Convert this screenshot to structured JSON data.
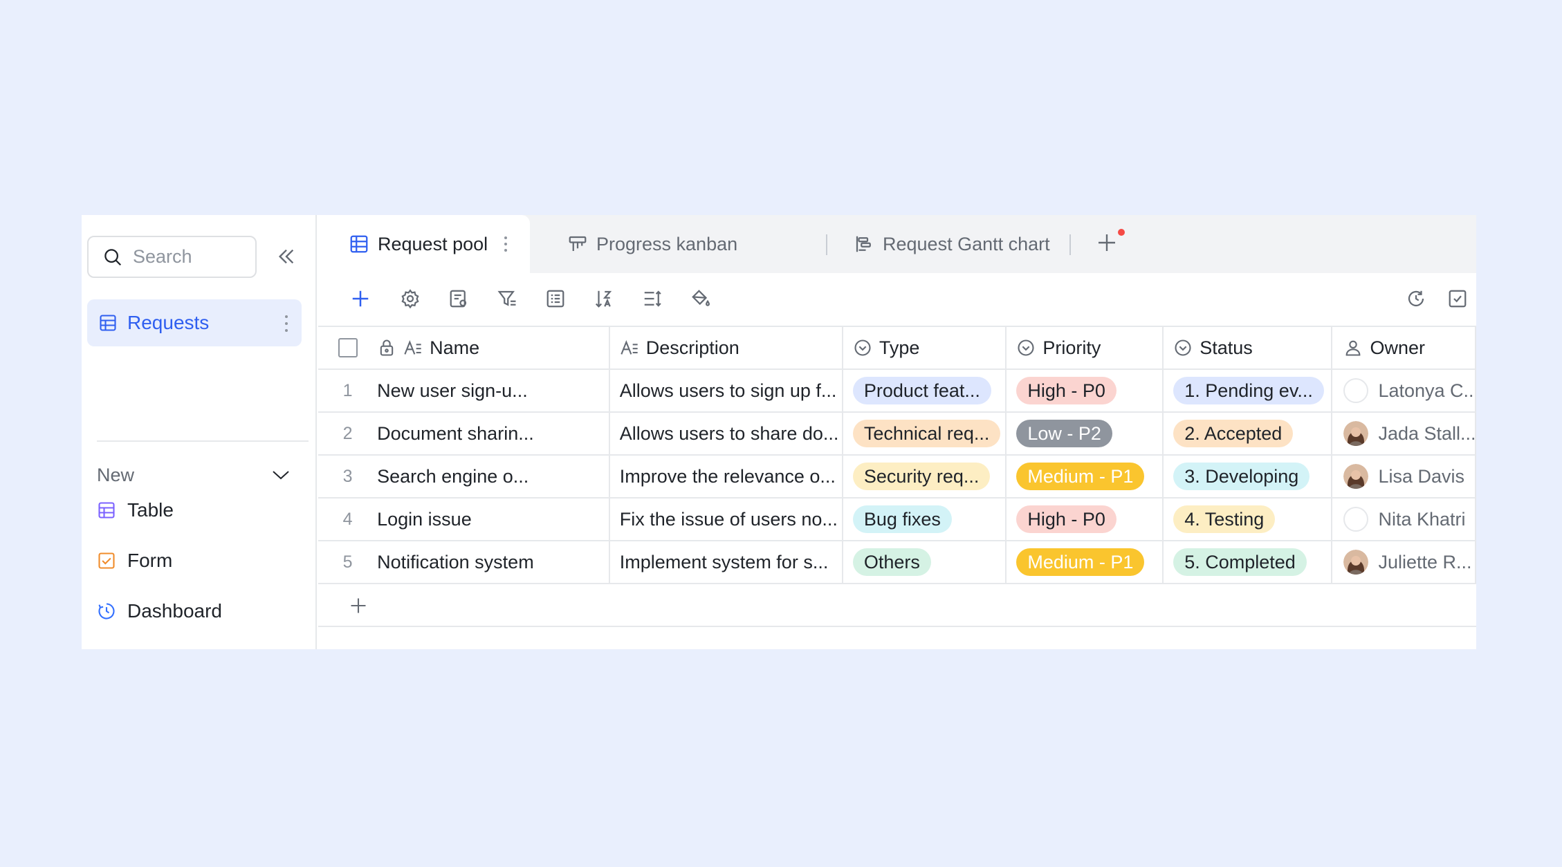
{
  "sidebar": {
    "search_placeholder": "Search",
    "active_item": "Requests",
    "new_label": "New",
    "create_items": [
      {
        "label": "Table",
        "icon": "table-icon",
        "color": "#7b61ff"
      },
      {
        "label": "Form",
        "icon": "form-icon",
        "color": "#f08c2b"
      },
      {
        "label": "Dashboard",
        "icon": "dashboard-icon",
        "color": "#3370ff"
      }
    ]
  },
  "tabs": [
    {
      "label": "Request pool",
      "icon": "grid-table-icon",
      "active": true
    },
    {
      "label": "Progress kanban",
      "icon": "kanban-icon",
      "active": false
    },
    {
      "label": "Request Gantt chart",
      "icon": "gantt-icon",
      "active": false
    }
  ],
  "columns": {
    "name": "Name",
    "description": "Description",
    "type": "Type",
    "priority": "Priority",
    "status": "Status",
    "owner": "Owner"
  },
  "rows": [
    {
      "index": "1",
      "name": "New user sign-u...",
      "description": "Allows users to sign up f...",
      "type": "Product feat...",
      "type_color": "#dde6fe",
      "priority": "High - P0",
      "priority_bg": "#fbd4d0",
      "priority_fg": "#1f2329",
      "status": "1. Pending ev...",
      "status_color": "#dde6fe",
      "owner": "Latonya C...",
      "avatar": "none"
    },
    {
      "index": "2",
      "name": "Document sharin...",
      "description": "Allows users to share do...",
      "type": "Technical req...",
      "type_color": "#fde2c4",
      "priority": "Low - P2",
      "priority_bg": "#8f959e",
      "priority_fg": "#ffffff",
      "status": "2. Accepted",
      "status_color": "#fde2c4",
      "owner": "Jada Stall...",
      "avatar": "photo"
    },
    {
      "index": "3",
      "name": "Search engine o...",
      "description": "Improve the relevance o...",
      "type": "Security req...",
      "type_color": "#fdeec3",
      "priority": "Medium - P1",
      "priority_bg": "#fac52e",
      "priority_fg": "#ffffff",
      "status": "3. Developing",
      "status_color": "#d3f3f7",
      "owner": "Lisa Davis",
      "avatar": "photo"
    },
    {
      "index": "4",
      "name": "Login issue",
      "description": "Fix the issue of users no...",
      "type": "Bug fixes",
      "type_color": "#d3f3f7",
      "priority": "High - P0",
      "priority_bg": "#fbd4d0",
      "priority_fg": "#1f2329",
      "status": "4. Testing",
      "status_color": "#fdeec3",
      "owner": "Nita Khatri",
      "avatar": "none"
    },
    {
      "index": "5",
      "name": "Notification system",
      "description": "Implement system for s...",
      "type": "Others",
      "type_color": "#d5f2e4",
      "priority": "Medium - P1",
      "priority_bg": "#fac52e",
      "priority_fg": "#ffffff",
      "status": "5. Completed",
      "status_color": "#d5f2e4",
      "owner": "Juliette R...",
      "avatar": "photo"
    }
  ],
  "colors": {
    "accent": "#2f5ff0",
    "page_bg": "#e9effd"
  }
}
